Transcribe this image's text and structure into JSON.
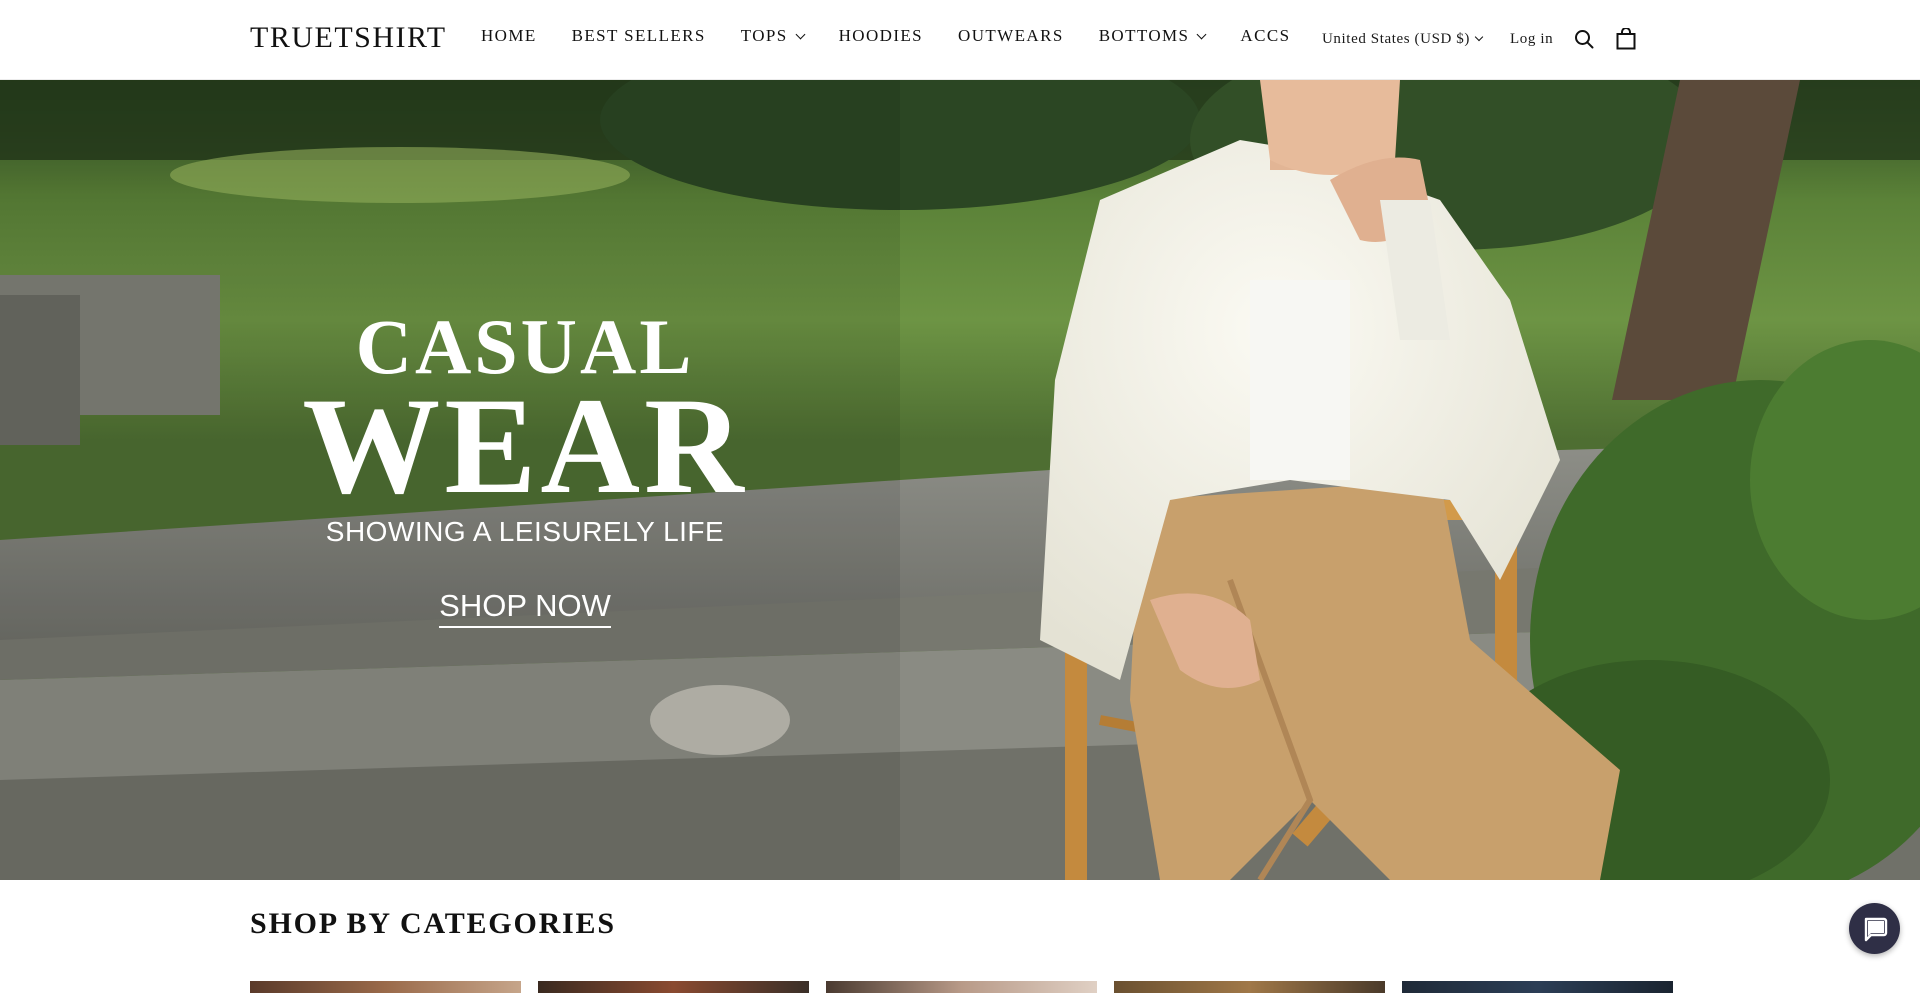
{
  "header": {
    "logo": "TRUETSHIRT",
    "nav": [
      {
        "label": "HOME",
        "dropdown": false
      },
      {
        "label": "BEST SELLERS",
        "dropdown": false
      },
      {
        "label": "TOPS",
        "dropdown": true
      },
      {
        "label": "HOODIES",
        "dropdown": false
      },
      {
        "label": "OUTWEARS",
        "dropdown": false
      },
      {
        "label": "BOTTOMS",
        "dropdown": true
      },
      {
        "label": "ACCS",
        "dropdown": false
      }
    ],
    "country_selector": "United States (USD $)",
    "login_label": "Log in",
    "icons": [
      "search-icon",
      "cart-bag-icon"
    ]
  },
  "hero": {
    "line1": "CASUAL",
    "line2": "WEAR",
    "subtitle": "SHOWING A LEISURELY LIFE",
    "cta": "SHOP NOW"
  },
  "categories": {
    "title": "SHOP BY CATEGORIES",
    "card_count": 5
  },
  "chat": {
    "icon": "chat-bubble-icon"
  },
  "colors": {
    "text": "#111111",
    "chat_button": "#2f2f46",
    "hero_text": "#ffffff"
  }
}
